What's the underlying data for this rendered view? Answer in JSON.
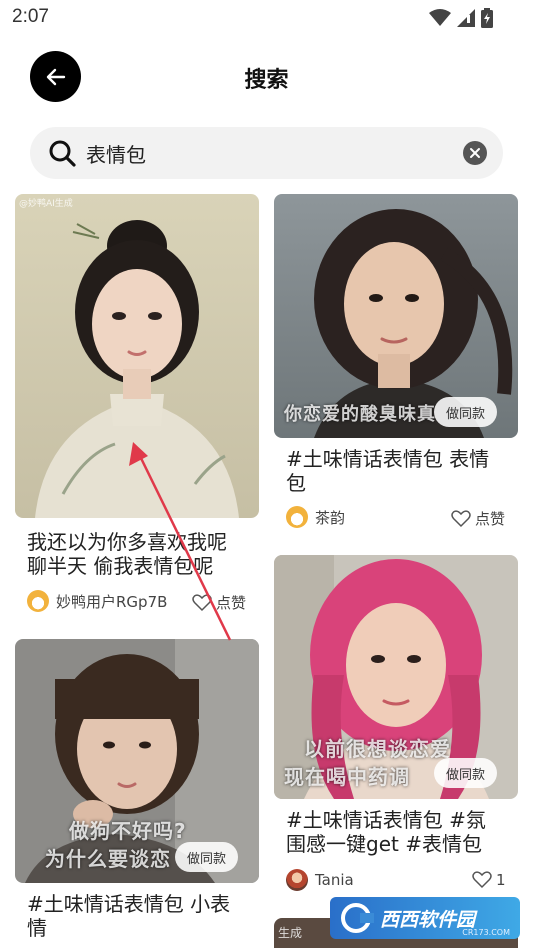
{
  "status": {
    "time": "2:07"
  },
  "header": {
    "title": "搜索"
  },
  "search": {
    "value": "表情包"
  },
  "feed": {
    "left": [
      {
        "title_line1": "我还以为你多喜欢我呢",
        "title_line2": "聊半天 偷我表情包呢",
        "author": "妙鸭用户RGp7B",
        "like_label": "点赞",
        "watermark": "@妙鸭AI生成"
      },
      {
        "title_line1": "#土味情话表情包 小表",
        "title_line2": "情",
        "overlay_line1": "做狗不好吗?",
        "overlay_line2": "为什么要谈恋",
        "same_label": "做同款"
      }
    ],
    "right": [
      {
        "title_line1": "#土味情话表情包 表情",
        "title_line2": "包",
        "author": "茶韵",
        "like_label": "点赞",
        "overlay_line1": "你恋爱的酸臭味真",
        "same_label": "做同款"
      },
      {
        "title_line1": "#土味情话表情包 #氛",
        "title_line2": "围感一键get #表情包",
        "author": "Tania",
        "like_count": "1",
        "overlay_line1": "以前很想谈恋爱",
        "overlay_line2": "现在喝中药调",
        "same_label": "做同款"
      },
      {
        "watermark": "生成"
      }
    ]
  },
  "site_badge": {
    "name": "西西软件园",
    "sub": "CR173.COM"
  },
  "colors": {
    "accent_arrow": "#e0394a",
    "back_button": "#000000",
    "search_bg": "#f2f2f2"
  }
}
